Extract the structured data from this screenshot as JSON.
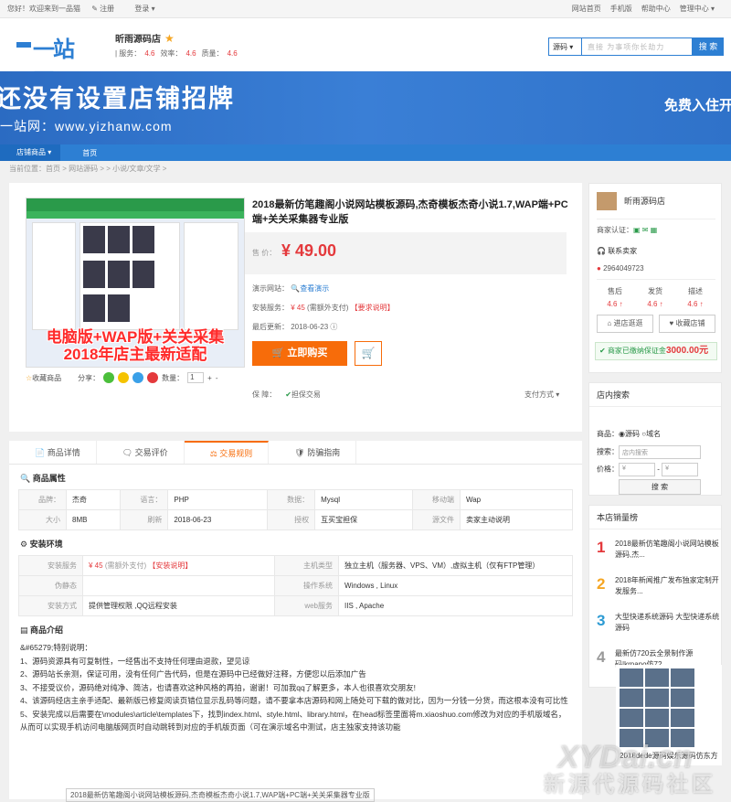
{
  "topbar": {
    "welcome": "您好！欢迎来到一品猫",
    "register": "注册",
    "login": "登录 ▾",
    "links": [
      "网站首页",
      "手机版",
      "帮助中心",
      "管理中心 ▾"
    ]
  },
  "header": {
    "logo": "一站网",
    "shop_name": "昕雨源码店",
    "ratings": "| 服务：",
    "service": "4.6",
    "speed_label": "效率：",
    "speed": "4.6",
    "quality_label": "质量：",
    "quality": "4.6"
  },
  "search": {
    "scope": "源码 ▾",
    "placeholder": "直接 为事项你长劫力",
    "button": "搜 索"
  },
  "banner": {
    "line1": "还没有设置店铺招牌",
    "line2": "一站网：www.yizhanw.com",
    "right": "免费入住开"
  },
  "nav": {
    "category": "店铺商品 ▾",
    "home": "首页"
  },
  "breadcrumb": "当前位置：首页 > 网站源码 > > 小说/文章/文学 >",
  "product": {
    "image_overlay_1": "电脑版+WAP版+关关采集",
    "image_overlay_2": "2018年店主最新适配",
    "title": "2018最新仿笔趣阁小说网站模板源码,杰奇模板杰奇小说1.7,WAP端+PC端+关关采集器专业版",
    "price_label": "售 价：",
    "price": "¥ 49.00",
    "demo_label": "演示网站：",
    "demo_link": "查看演示",
    "install_label": "安装服务：",
    "install_price": "¥ 45",
    "install_note": "(需额外支付)",
    "install_req": "【要求说明】",
    "update_label": "最后更新：",
    "update_date": "2018-06-23",
    "buy_button": "立即购买",
    "guarantee_label": "保    障：",
    "guarantee": "担保交易",
    "payment": "支付方式 ▾",
    "fav": "收藏商品",
    "share": "分享：",
    "qty_label": "数量：",
    "qty": "1"
  },
  "tabs": [
    "商品详情",
    "交易评价",
    "交易规则",
    "防骗指南"
  ],
  "attrs": {
    "section": "商品属性",
    "rows": [
      [
        {
          "k": "品牌：",
          "v": "杰奇"
        },
        {
          "k": "语言：",
          "v": "PHP"
        },
        {
          "k": "数据：",
          "v": "Mysql"
        },
        {
          "k": "移动端",
          "v": "Wap"
        }
      ],
      [
        {
          "k": "大小",
          "v": "8MB"
        },
        {
          "k": "刷新",
          "v": "2018-06-23"
        },
        {
          "k": "授权",
          "v": "互买宝担保"
        },
        {
          "k": "源文件",
          "v": "卖家主动说明"
        }
      ]
    ]
  },
  "env": {
    "section": "安装环境",
    "install_k": "安装服务",
    "install_v": "¥ 45",
    "install_note": "(需额外支付)",
    "install_req": "【安装说明】",
    "host_k": "主机类型",
    "host_v": "独立主机（服务器、VPS、VM）,虚拟主机（仅有FTP管理）",
    "rewrite_k": "伪静态",
    "rewrite_v": "",
    "os_k": "操作系统",
    "os_v": "Windows , Linux",
    "method_k": "安装方式",
    "method_v": "提供管理权限 ,QQ远程安装",
    "web_k": "web服务",
    "web_v": "IIS , Apache"
  },
  "intro": {
    "section": "商品介绍",
    "lines": [
      "&#65279;特别说明：",
      "1、源码资源具有可复制性，一经售出不支持任何理由退款，望见谅",
      "2、源码站长亲测，保证可用，没有任何广告代码，但是在源码中已经做好注释，方便您以后添加广告",
      "3、不接受议价，源码绝对纯净、简洁，也请喜欢这种风格的再拍，谢谢！可加我qq了解更多，本人也很喜欢交朋友!",
      "4、该源码经店主亲手适配、最新版已修复阅读页错位显示乱码等问题，请不要拿本店源码和网上随处可下载的做对比，因为一分钱一分货，而这根本没有可比性",
      "5、安装完成以后需要在\\modules\\article\\templates下，找到index.html、style.html、library.html，在head标签里面将m.xiaoshuo.com修改为对应的手机版域名，从而可以实现手机访问电脑版网页时自动跳转到对应的手机版页面（可在演示域名中测试，店主独家支持该功能"
    ],
    "image_caption": "2018最新仿笔趣阁小说网站模板源码,杰奇模板杰奇小说1.7,WAP端+PC端+关关采集器专业版"
  },
  "sidebar": {
    "shop_name": "昕雨源码店",
    "cert_label": "商家认证：",
    "contact": "联系卖家",
    "qq": "2964049723",
    "scores": [
      {
        "label": "售后",
        "v": "4.6 ↑"
      },
      {
        "label": "发货",
        "v": "4.6 ↑"
      },
      {
        "label": "描述",
        "v": "4.6 ↑"
      }
    ],
    "visit_btn": "进店逛逛",
    "fav_btn": "收藏店铺",
    "deposit_label": "商家已缴纳保证金",
    "deposit": "3000.00元",
    "search_title": "店内搜索",
    "goods_label": "商品：",
    "opt1": "源码",
    "opt2": "域名",
    "kw_label": "搜索：",
    "kw_ph": "店内搜索",
    "price_label": "价格：",
    "price_ph": "¥",
    "search_btn": "搜 索",
    "hot_title": "本店销量榜",
    "hot": [
      {
        "no": "1",
        "color": "#e4393c",
        "text": "2018最新仿笔趣阁小说网站模板源码,杰..."
      },
      {
        "no": "2",
        "color": "#f5a623",
        "text": "2018年新闻推广发布独家定制开发服务..."
      },
      {
        "no": "3",
        "color": "#2d9bd3",
        "text": "大型快递系统源码 大型快递系统源码"
      },
      {
        "no": "4",
        "color": "#999999",
        "text": "最新仿720云全景制作源码|krpano仿72..."
      }
    ],
    "thumb_caption": "2018dede源码娱乐源码仿东方"
  },
  "watermark": {
    "main": "XYDai.cn",
    "sub": "新源代源码社区"
  }
}
